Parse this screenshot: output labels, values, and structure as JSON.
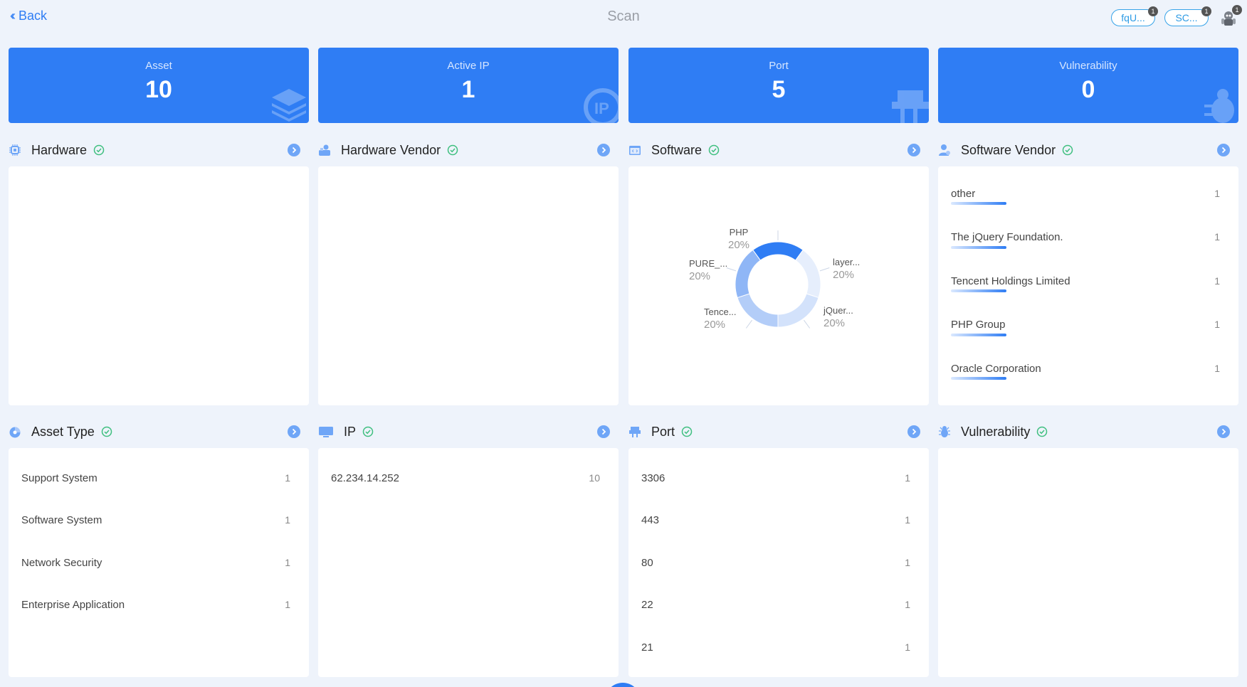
{
  "header": {
    "back_label": "Back",
    "title": "Scan",
    "pills": [
      {
        "label": "fqU...",
        "badge": "1"
      },
      {
        "label": "SC...",
        "badge": "1"
      }
    ],
    "robot_badge": "1"
  },
  "stats": [
    {
      "label": "Asset",
      "value": "10",
      "icon": "layers-icon"
    },
    {
      "label": "Active IP",
      "value": "1",
      "icon": "ip-icon"
    },
    {
      "label": "Port",
      "value": "5",
      "icon": "port-icon"
    },
    {
      "label": "Vulnerability",
      "value": "0",
      "icon": "bug-icon"
    }
  ],
  "sections": {
    "hardware": {
      "title": "Hardware",
      "rows": []
    },
    "hardware_vendor": {
      "title": "Hardware Vendor",
      "rows": []
    },
    "software": {
      "title": "Software"
    },
    "software_vendor": {
      "title": "Software Vendor",
      "rows": [
        {
          "label": "other",
          "count": "1"
        },
        {
          "label": "The jQuery Foundation.",
          "count": "1"
        },
        {
          "label": "Tencent Holdings Limited",
          "count": "1"
        },
        {
          "label": "PHP Group",
          "count": "1"
        },
        {
          "label": "Oracle Corporation",
          "count": "1"
        }
      ]
    },
    "asset_type": {
      "title": "Asset Type",
      "rows": [
        {
          "label": "Support System",
          "count": "1"
        },
        {
          "label": "Software System",
          "count": "1"
        },
        {
          "label": "Network Security",
          "count": "1"
        },
        {
          "label": "Enterprise Application",
          "count": "1"
        }
      ]
    },
    "ip": {
      "title": "IP",
      "rows": [
        {
          "label": "62.234.14.252",
          "count": "10"
        }
      ]
    },
    "port": {
      "title": "Port",
      "rows": [
        {
          "label": "3306",
          "count": "1"
        },
        {
          "label": "443",
          "count": "1"
        },
        {
          "label": "80",
          "count": "1"
        },
        {
          "label": "22",
          "count": "1"
        },
        {
          "label": "21",
          "count": "1"
        }
      ]
    },
    "vulnerability": {
      "title": "Vulnerability",
      "rows": []
    }
  },
  "chart_data": {
    "type": "pie",
    "donut": true,
    "slices": [
      {
        "label": "PHP",
        "pct": "20%",
        "value": 20,
        "color": "#2f7df4"
      },
      {
        "label": "layer...",
        "pct": "20%",
        "value": 20,
        "color": "#e6eefc"
      },
      {
        "label": "jQuer...",
        "pct": "20%",
        "value": 20,
        "color": "#d3e2fb"
      },
      {
        "label": "Tence...",
        "pct": "20%",
        "value": 20,
        "color": "#b3cdf8"
      },
      {
        "label": "PURE_...",
        "pct": "20%",
        "value": 20,
        "color": "#8fb6f6"
      }
    ]
  },
  "colors": {
    "accent": "#2f7df4",
    "check": "#3fbf7f",
    "background": "#eef3fb"
  }
}
